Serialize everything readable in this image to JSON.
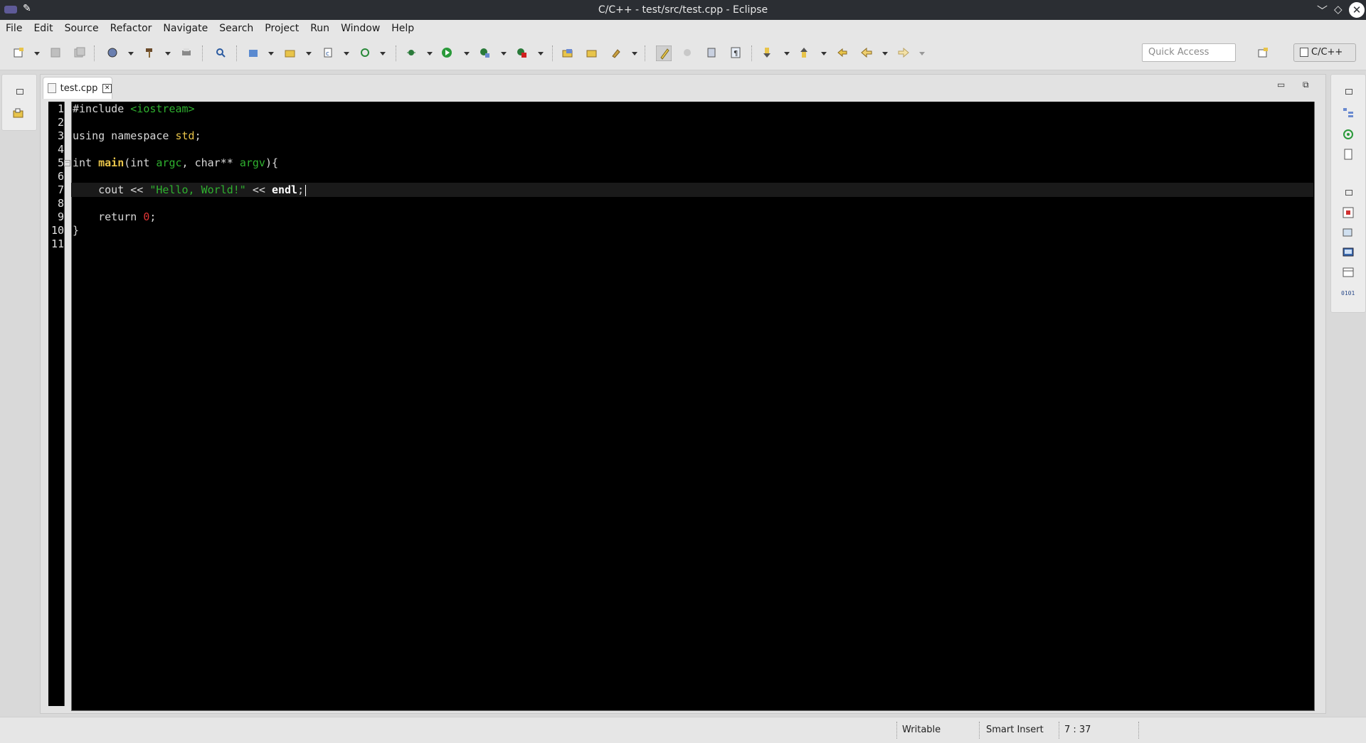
{
  "window": {
    "title": "C/C++ - test/src/test.cpp - Eclipse"
  },
  "menu": [
    "File",
    "Edit",
    "Source",
    "Refactor",
    "Navigate",
    "Search",
    "Project",
    "Run",
    "Window",
    "Help"
  ],
  "toolbar": {
    "quick_access_placeholder": "Quick Access",
    "perspective_label": "C/C++"
  },
  "editor": {
    "tab_label": "test.cpp",
    "line_numbers": [
      "1",
      "2",
      "3",
      "4",
      "5",
      "6",
      "7",
      "8",
      "9",
      "10",
      "11"
    ],
    "code": {
      "l1_a": "#include ",
      "l1_b": "<iostream>",
      "l3_a": "using namespace ",
      "l3_b": "std",
      "l3_c": ";",
      "l5_a": "int ",
      "l5_b": "main",
      "l5_c": "(int ",
      "l5_d": "argc",
      "l5_e": ", char** ",
      "l5_f": "argv",
      "l5_g": "){",
      "l7_a": "    cout << ",
      "l7_b": "\"Hello, World!\"",
      "l7_c": " << ",
      "l7_d": "endl",
      "l7_e": ";",
      "l9_a": "    return ",
      "l9_b": "0",
      "l9_c": ";",
      "l10_a": "}"
    }
  },
  "status": {
    "writable": "Writable",
    "insert_mode": "Smart Insert",
    "cursor_position": "7 : 37"
  },
  "colors": {
    "editor_bg": "#000000",
    "keyword_yellow": "#e8c44a",
    "string_green": "#2fb12f",
    "number_red": "#e03535"
  }
}
